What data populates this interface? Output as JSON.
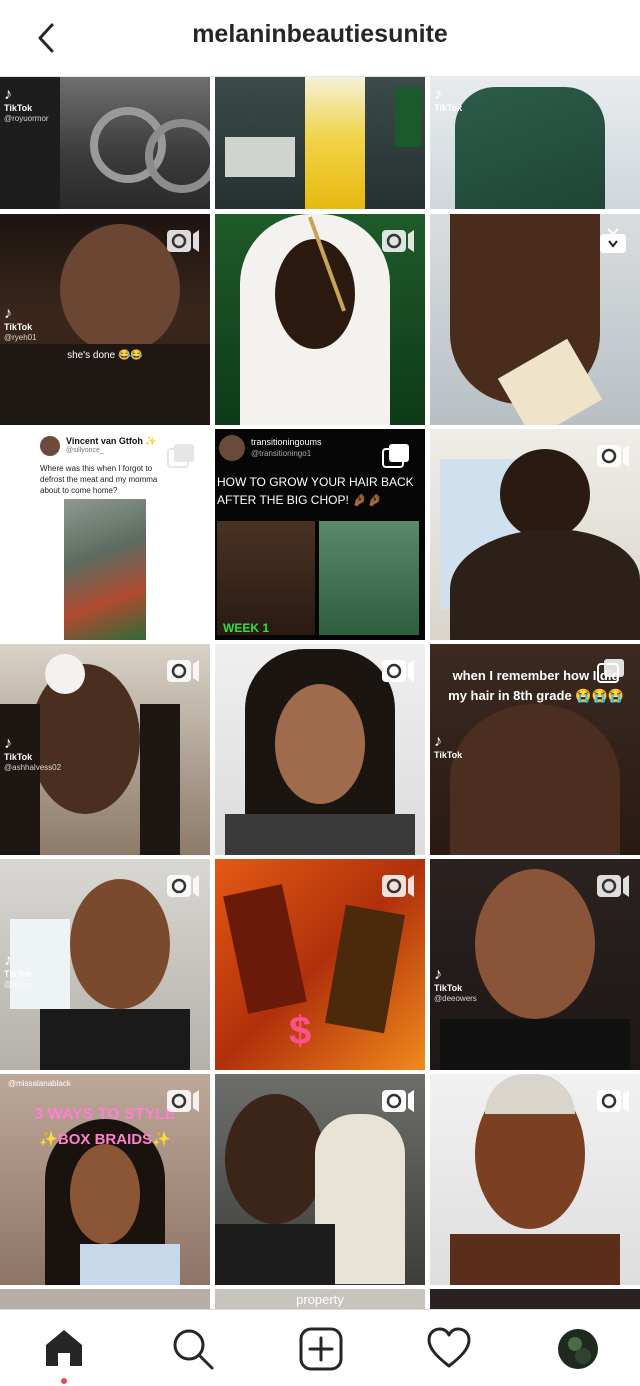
{
  "header": {
    "title": "melaninbeautiesunite",
    "back_icon": "chevron-left-icon"
  },
  "tiktok_label": "TikTok",
  "tiles": {
    "t1": {
      "handle": "@royuormor"
    },
    "t3": {
      "handle": ""
    },
    "t4": {
      "handle": "@ryeh01",
      "caption": "she's done 😂😂"
    },
    "t7": {
      "tweet_name": "Vincent van Gtfoh ✨",
      "tweet_handle": "@sillyonce_",
      "tweet_text": "Where was this when I forgot to defrost the meat and my momma about to come home?"
    },
    "t8": {
      "account_name": "transitioningoums",
      "account_handle": "@transitioningo1",
      "headline": "HOW TO GROW YOUR HAIR BACK AFTER THE BIG CHOP! 🤌🏾🤌🏾",
      "week_label": "WEEK 1"
    },
    "t10": {
      "handle": "@ashhalvess02"
    },
    "t12": {
      "handle": "",
      "caption": "when I remember how I did my hair in 8th grade 😭😭😭"
    },
    "t13": {
      "handle": "@msrpv"
    },
    "t15": {
      "handle": "@deeowers"
    },
    "t16": {
      "handle": "@missalanablack",
      "caption_line1": "3 WAYS TO STYLE",
      "caption_line2": "✨BOX BRAIDS✨"
    },
    "t20": {
      "caption": "property"
    }
  },
  "nav": {
    "items": [
      "home-icon",
      "search-icon",
      "create-post-icon",
      "activity-heart-icon",
      "profile-avatar"
    ],
    "active": "home-icon",
    "notification_dot_color": "#ed4956"
  },
  "colors": {
    "text": "#262626",
    "border": "#dbdbdb",
    "week_green": "#31e13c"
  }
}
